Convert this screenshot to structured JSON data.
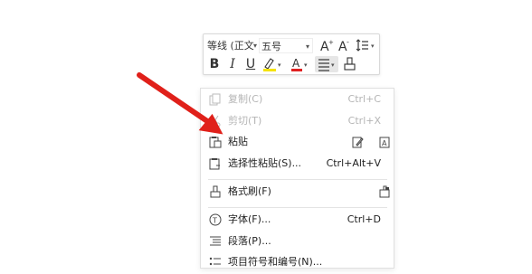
{
  "toolbar": {
    "font_name": "等线 (正文",
    "font_size": "五号",
    "bold": "B",
    "italic": "I",
    "underline": "U",
    "font_color": "A",
    "highlight_color": "#f5e300",
    "font_color_swatch": "#e02020"
  },
  "menu": {
    "items": [
      {
        "label": "复制(C)",
        "shortcut": "Ctrl+C",
        "icon": "copy-icon",
        "disabled": true
      },
      {
        "label": "剪切(T)",
        "shortcut": "Ctrl+X",
        "icon": "cut-icon",
        "disabled": true
      },
      {
        "label": "粘贴",
        "shortcut": "",
        "icon": "paste-icon",
        "disabled": false
      },
      {
        "label": "选择性粘贴(S)...",
        "shortcut": "Ctrl+Alt+V",
        "icon": "paste-special-icon",
        "disabled": false
      },
      {
        "label": "格式刷(F)",
        "shortcut": "",
        "icon": "format-painter-icon",
        "disabled": false
      },
      {
        "label": "字体(F)...",
        "shortcut": "Ctrl+D",
        "icon": "font-icon",
        "disabled": false
      },
      {
        "label": "段落(P)...",
        "shortcut": "",
        "icon": "paragraph-icon",
        "disabled": false
      },
      {
        "label": "项目符号和编号(N)...",
        "shortcut": "",
        "icon": "bullets-icon",
        "disabled": false
      }
    ]
  },
  "annotation": {
    "arrow_color": "#e0201a"
  }
}
